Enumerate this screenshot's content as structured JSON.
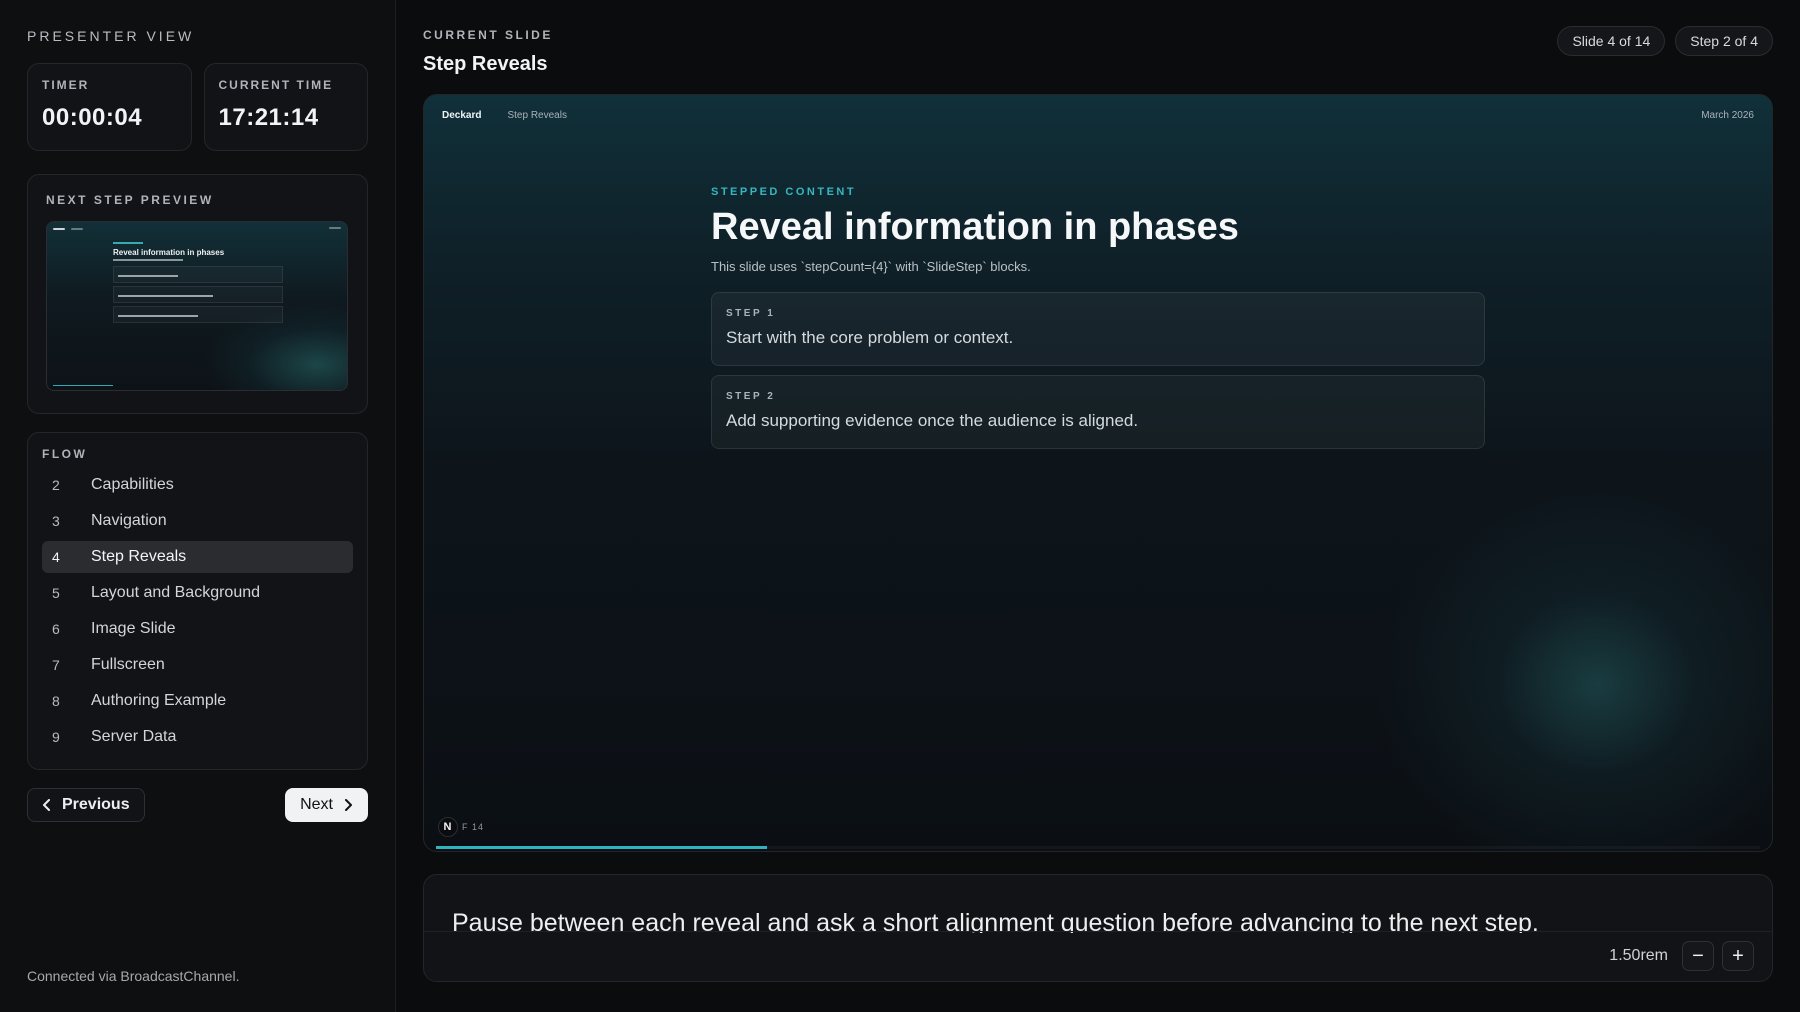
{
  "sidebar": {
    "title": "PRESENTER VIEW",
    "timer": {
      "label": "TIMER",
      "value": "00:00:04"
    },
    "current_time": {
      "label": "CURRENT TIME",
      "value": "17:21:14"
    },
    "next_step_preview": {
      "label": "NEXT STEP PREVIEW",
      "title": "Reveal information in phases"
    },
    "flow": {
      "label": "FLOW",
      "items": [
        {
          "num": "2",
          "label": "Capabilities"
        },
        {
          "num": "3",
          "label": "Navigation"
        },
        {
          "num": "4",
          "label": "Step Reveals"
        },
        {
          "num": "5",
          "label": "Layout and Background"
        },
        {
          "num": "6",
          "label": "Image Slide"
        },
        {
          "num": "7",
          "label": "Fullscreen"
        },
        {
          "num": "8",
          "label": "Authoring Example"
        },
        {
          "num": "9",
          "label": "Server Data"
        }
      ],
      "active_num": "4"
    },
    "previous_label": "Previous",
    "next_label": "Next",
    "connection_status": "Connected via BroadcastChannel."
  },
  "main": {
    "kicker": "CURRENT SLIDE",
    "title": "Step Reveals",
    "slide_counter": "Slide 4 of 14",
    "step_counter": "Step 2 of 4",
    "progress_fraction": 0.25
  },
  "slide": {
    "brand": "Deckard",
    "section": "Step Reveals",
    "date": "March 2026",
    "kicker": "STEPPED CONTENT",
    "title": "Reveal information in phases",
    "subtitle": "This slide uses `stepCount={4}` with `SlideStep` blocks.",
    "steps": [
      {
        "label": "STEP 1",
        "text": "Start with the core problem or context."
      },
      {
        "label": "STEP 2",
        "text": "Add supporting evidence once the audience is aligned."
      }
    ],
    "badge": "N",
    "corner_text": "F 14"
  },
  "notes": {
    "text": "Pause between each reveal and ask a short alignment question before advancing to the next step.",
    "font_size_label": "1.50rem",
    "decrease_symbol": "−",
    "increase_symbol": "+"
  },
  "colors": {
    "accent": "#2fb4bf",
    "background": "#0b0c0e"
  },
  "icons": {
    "previous": "chevron-left-icon",
    "next": "chevron-right-icon"
  }
}
